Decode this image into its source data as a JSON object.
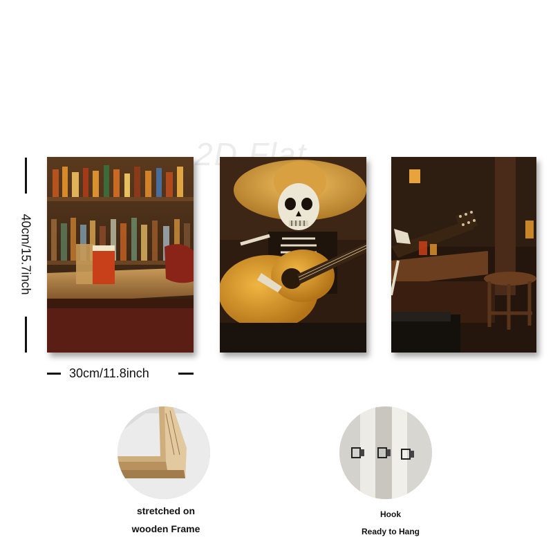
{
  "watermark": "2D Flat",
  "dimensions": {
    "height_label": "40cm/15.7inch",
    "width_label": "30cm/11.8inch"
  },
  "panels": [
    {
      "name": "bar-counter-panel"
    },
    {
      "name": "skeleton-guitar-panel"
    },
    {
      "name": "bar-interior-panel"
    }
  ],
  "details": {
    "frame": {
      "caption_line1": "stretched on",
      "caption_line2": "wooden Frame"
    },
    "hook": {
      "caption_line1": "Hook",
      "caption_line2": "Ready to Hang"
    }
  },
  "colors": {
    "dark_wood": "#3a2414",
    "amber": "#d99a2b",
    "straw": "#d6a244",
    "beer": "#c8401a",
    "pine": "#e3c9a0"
  }
}
